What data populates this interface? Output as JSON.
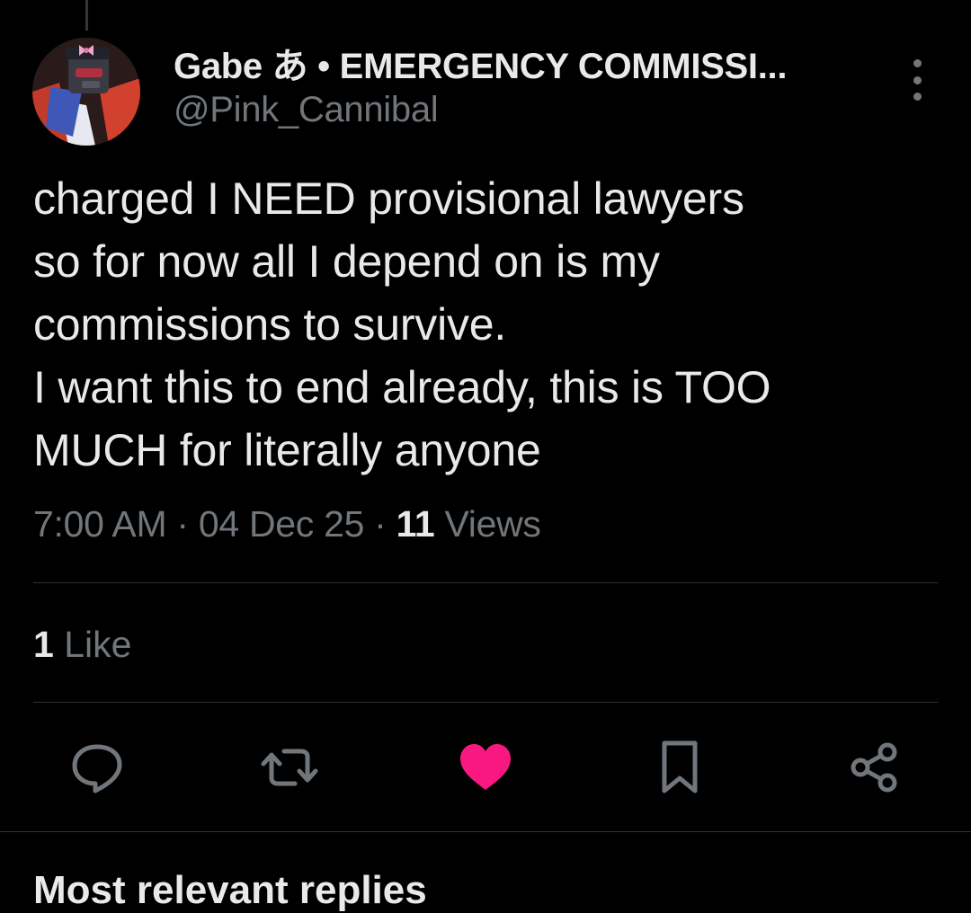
{
  "author": {
    "display_name": "Gabe あ • EMERGENCY COMMISSI...",
    "handle": "@Pink_Cannibal",
    "avatar_icon": "avatar-robot-character"
  },
  "tweet": {
    "lines": [
      "charged I NEED provisional lawyers",
      "so for now all I depend on is my",
      "commissions to survive.",
      "I want this to end already, this is TOO",
      "MUCH for literally anyone"
    ],
    "time": "7:00 AM",
    "date": "04 Dec 25",
    "views_count": "11",
    "views_label": "Views",
    "separator": "·"
  },
  "engagement": {
    "likes_count": "1",
    "likes_label": "Like"
  },
  "actions": [
    {
      "name": "reply",
      "icon": "speech-bubble-icon"
    },
    {
      "name": "repost",
      "icon": "repost-arrows-icon"
    },
    {
      "name": "like",
      "icon": "heart-icon",
      "active": true,
      "color": "#f91880"
    },
    {
      "name": "bookmark",
      "icon": "bookmark-icon"
    },
    {
      "name": "share",
      "icon": "share-nodes-icon"
    }
  ],
  "next_section_title": "Most relevant replies",
  "colors": {
    "background": "#000000",
    "text_primary": "#e7e9ea",
    "text_secondary": "#71767b",
    "like_active": "#f91880",
    "divider": "#2f3336"
  }
}
